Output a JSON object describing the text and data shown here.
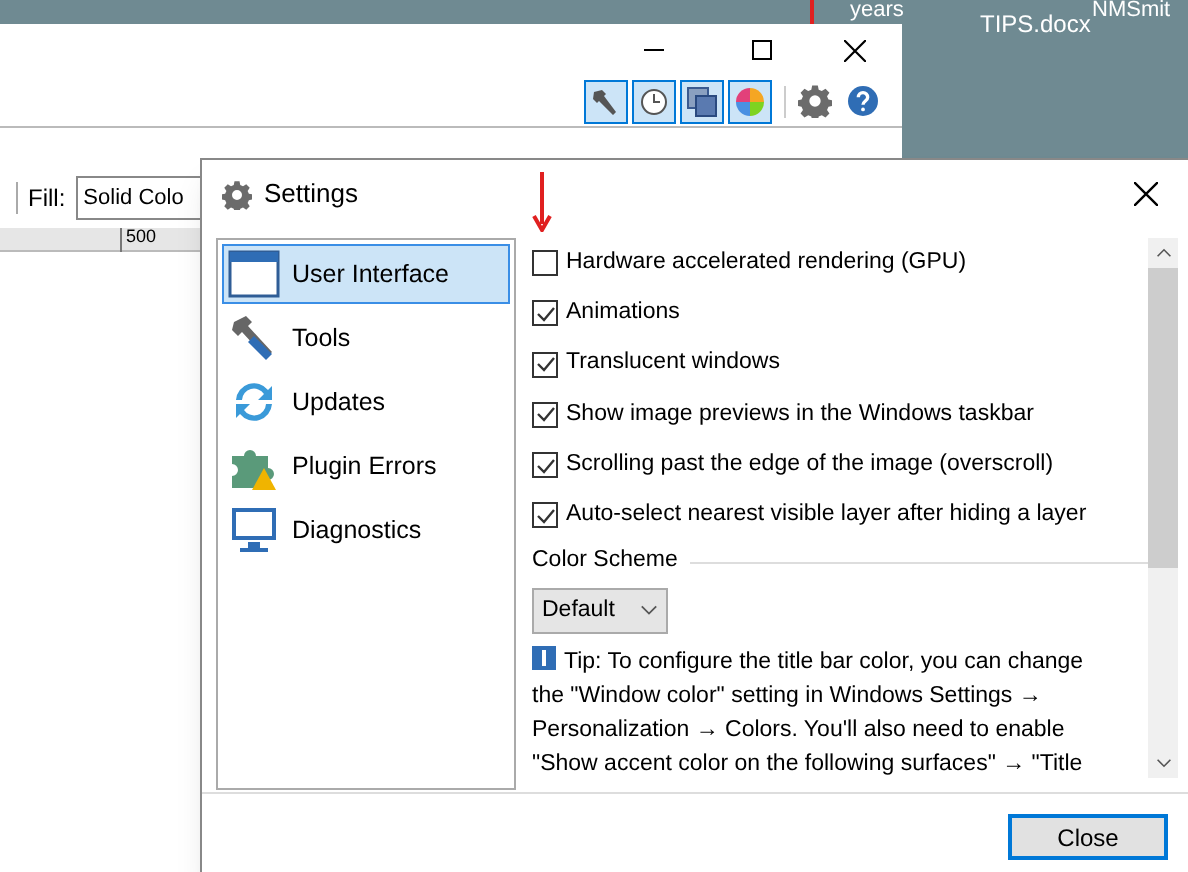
{
  "desktop": {
    "icons": [
      {
        "label": "years"
      },
      {
        "label": "TIPS.docx"
      },
      {
        "label": "NMSmit"
      }
    ]
  },
  "main_window": {
    "toolbar_buttons": [
      {
        "kind": "tools",
        "selected": true
      },
      {
        "kind": "history",
        "selected": true
      },
      {
        "kind": "layers",
        "selected": true
      },
      {
        "kind": "colors",
        "selected": true
      }
    ],
    "fill_label": "Fill:",
    "fill_value": "Solid Colo",
    "ruler_mark": "500"
  },
  "dialog": {
    "title": "Settings",
    "nav_items": [
      {
        "label": "User Interface",
        "selected": true
      },
      {
        "label": "Tools",
        "selected": false
      },
      {
        "label": "Updates",
        "selected": false
      },
      {
        "label": "Plugin Errors",
        "selected": false
      },
      {
        "label": "Diagnostics",
        "selected": false
      }
    ],
    "options": [
      {
        "label": "Hardware accelerated rendering (GPU)",
        "checked": false
      },
      {
        "label": "Animations",
        "checked": true
      },
      {
        "label": "Translucent windows",
        "checked": true
      },
      {
        "label": "Show image previews in the Windows taskbar",
        "checked": true
      },
      {
        "label": "Scrolling past the edge of the image (overscroll)",
        "checked": true
      },
      {
        "label": "Auto-select nearest visible layer after hiding a layer",
        "checked": true
      }
    ],
    "color_scheme": {
      "label": "Color Scheme",
      "value": "Default"
    },
    "tip_lines": [
      "Tip: To configure the title bar color, you can change",
      "the \"Window color\" setting in Windows Settings →",
      "Personalization → Colors. You'll also need to enable",
      "\"Show accent color on the following surfaces\" → \"Title"
    ],
    "close_button": "Close"
  }
}
